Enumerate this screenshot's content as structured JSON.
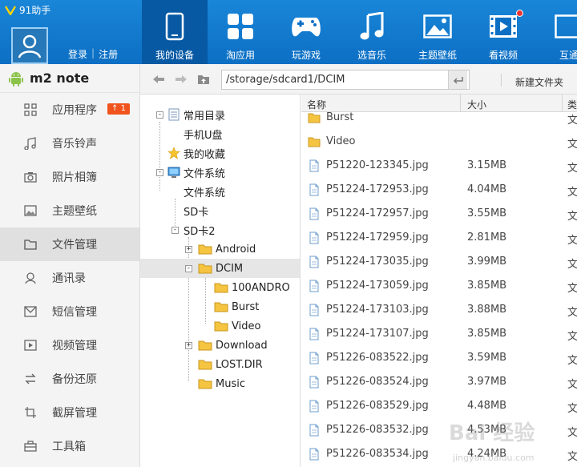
{
  "app": {
    "title": "91助手"
  },
  "account": {
    "login": "登录",
    "separator": "|",
    "register": "注册"
  },
  "nav": [
    {
      "label": "我的设备",
      "icon": "phone-icon",
      "active": true
    },
    {
      "label": "淘应用",
      "icon": "apps-grid-icon"
    },
    {
      "label": "玩游戏",
      "icon": "gamepad-icon"
    },
    {
      "label": "选音乐",
      "icon": "music-note-icon"
    },
    {
      "label": "主题壁纸",
      "icon": "picture-icon"
    },
    {
      "label": "看视频",
      "icon": "film-icon",
      "dot": true
    },
    {
      "label": "互通",
      "icon": "exchange-icon"
    }
  ],
  "device": {
    "name": "m2 note",
    "icon": "android-icon"
  },
  "sidebar": {
    "items": [
      {
        "label": "应用程序",
        "icon": "apps-icon",
        "badge": "1"
      },
      {
        "label": "音乐铃声",
        "icon": "music-icon"
      },
      {
        "label": "照片相簿",
        "icon": "camera-icon"
      },
      {
        "label": "主题壁纸",
        "icon": "wallpaper-icon"
      },
      {
        "label": "文件管理",
        "icon": "folder-icon",
        "active": true
      },
      {
        "label": "通讯录",
        "icon": "contacts-icon"
      },
      {
        "label": "短信管理",
        "icon": "sms-icon"
      },
      {
        "label": "视频管理",
        "icon": "video-icon"
      },
      {
        "label": "备份还原",
        "icon": "backup-icon"
      },
      {
        "label": "截屏管理",
        "icon": "screenshot-icon"
      },
      {
        "label": "工具箱",
        "icon": "toolbox-icon"
      }
    ]
  },
  "toolbar": {
    "path": "/storage/sdcard1/DCIM",
    "new_folder": "新建文件夹"
  },
  "tree": [
    {
      "label": "常用目录",
      "icon": "common-dir-icon",
      "expander": "-"
    },
    {
      "label": "手机U盘",
      "icon": ""
    },
    {
      "label": "我的收藏",
      "icon": "star-icon"
    },
    {
      "label": "文件系统",
      "icon": "computer-icon",
      "expander": "-"
    },
    {
      "label": "文件系统",
      "icon": ""
    },
    {
      "label": "SD卡",
      "icon": ""
    },
    {
      "label": "SD卡2",
      "icon": "",
      "expander": "-"
    },
    {
      "label": "Android",
      "icon": "folder-icon",
      "expander": "+"
    },
    {
      "label": "DCIM",
      "icon": "folder-icon",
      "expander": "-",
      "selected": true
    },
    {
      "label": "100ANDRO",
      "icon": "folder-icon"
    },
    {
      "label": "Burst",
      "icon": "folder-icon"
    },
    {
      "label": "Video",
      "icon": "folder-icon"
    },
    {
      "label": "Download",
      "icon": "folder-icon",
      "expander": "+"
    },
    {
      "label": "LOST.DIR",
      "icon": "folder-icon"
    },
    {
      "label": "Music",
      "icon": "folder-icon"
    }
  ],
  "list": {
    "columns": {
      "name": "名称",
      "size": "大小",
      "type": "类"
    },
    "rows": [
      {
        "name": "Burst",
        "size": "",
        "type": "文",
        "kind": "folder"
      },
      {
        "name": "Video",
        "size": "",
        "type": "文",
        "kind": "folder"
      },
      {
        "name": "P51220-123345.jpg",
        "size": "3.15MB",
        "type": "文",
        "kind": "file"
      },
      {
        "name": "P51224-172953.jpg",
        "size": "4.04MB",
        "type": "文",
        "kind": "file"
      },
      {
        "name": "P51224-172957.jpg",
        "size": "3.55MB",
        "type": "文",
        "kind": "file"
      },
      {
        "name": "P51224-172959.jpg",
        "size": "2.81MB",
        "type": "文",
        "kind": "file"
      },
      {
        "name": "P51224-173035.jpg",
        "size": "3.99MB",
        "type": "文",
        "kind": "file"
      },
      {
        "name": "P51224-173059.jpg",
        "size": "3.85MB",
        "type": "文",
        "kind": "file"
      },
      {
        "name": "P51224-173103.jpg",
        "size": "3.88MB",
        "type": "文",
        "kind": "file"
      },
      {
        "name": "P51224-173107.jpg",
        "size": "3.85MB",
        "type": "文",
        "kind": "file"
      },
      {
        "name": "P51226-083522.jpg",
        "size": "3.59MB",
        "type": "文",
        "kind": "file"
      },
      {
        "name": "P51226-083524.jpg",
        "size": "3.97MB",
        "type": "文",
        "kind": "file"
      },
      {
        "name": "P51226-083529.jpg",
        "size": "4.48MB",
        "type": "文",
        "kind": "file"
      },
      {
        "name": "P51226-083532.jpg",
        "size": "4.53MB",
        "type": "文",
        "kind": "file"
      },
      {
        "name": "P51226-083534.jpg",
        "size": "4.24MB",
        "type": "文",
        "kind": "file"
      }
    ]
  },
  "watermark": {
    "main": "Bai 经验",
    "sub": "jingyan.baidu.com"
  },
  "colors": {
    "header": "#0c6fc4",
    "nav_active": "#0759a4",
    "badge": "#f0541c",
    "folder": "#f5c542"
  }
}
